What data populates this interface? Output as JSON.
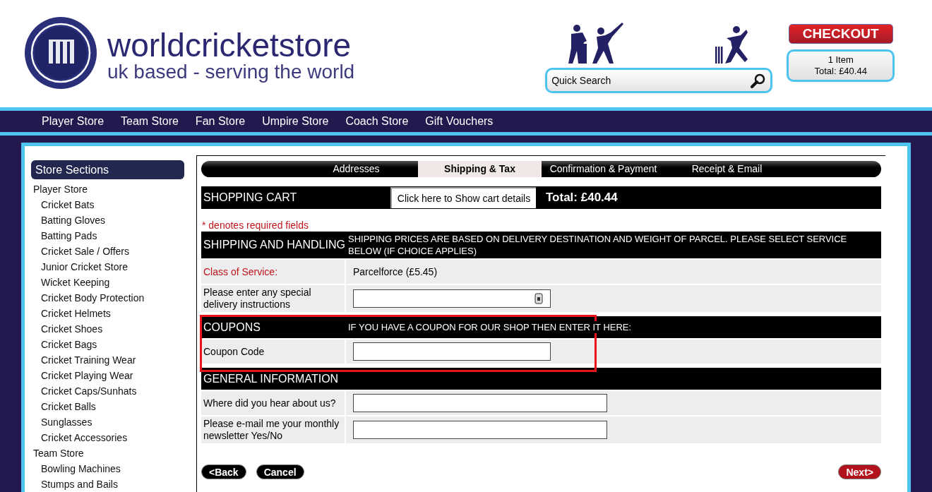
{
  "header": {
    "brand": "worldcricketstore",
    "tagline": "uk based - serving the world",
    "search": {
      "placeholder": "Quick Search"
    },
    "checkout": "CHECKOUT",
    "cart": {
      "items": "1 Item",
      "total": "Total: £40.44"
    }
  },
  "nav": [
    "Player Store",
    "Team Store",
    "Fan Store",
    "Umpire Store",
    "Coach Store",
    "Gift Vouchers"
  ],
  "sidebar": {
    "title": "Store Sections",
    "items": [
      {
        "label": "Player Store",
        "children": [
          {
            "label": "Cricket Bats"
          },
          {
            "label": "Batting Gloves"
          },
          {
            "label": "Batting Pads"
          },
          {
            "label": "Cricket Sale / Offers"
          },
          {
            "label": "Junior Cricket Store"
          },
          {
            "label": "Wicket Keeping"
          },
          {
            "label": "Cricket Body Protection"
          },
          {
            "label": "Cricket Helmets"
          },
          {
            "label": "Cricket Shoes"
          },
          {
            "label": "Cricket Bags"
          },
          {
            "label": "Cricket Training Wear"
          },
          {
            "label": "Cricket Playing Wear"
          },
          {
            "label": "Cricket Caps/Sunhats"
          },
          {
            "label": "Cricket Balls"
          },
          {
            "label": "Sunglasses"
          },
          {
            "label": "Cricket Accessories"
          }
        ]
      },
      {
        "label": "Team Store",
        "children": [
          {
            "label": "Bowling Machines"
          },
          {
            "label": "Stumps and Bails"
          }
        ]
      }
    ]
  },
  "steps": [
    {
      "label": "Addresses",
      "selected": false
    },
    {
      "label": "Shipping & Tax",
      "selected": true
    },
    {
      "label": "Confirmation & Payment",
      "selected": false
    },
    {
      "label": "Receipt & Email",
      "selected": false
    }
  ],
  "cart_bar": {
    "title": "SHOPPING CART",
    "details_button": "Click here to Show cart details",
    "total": "Total: £40.44"
  },
  "required_note": "* denotes required fields",
  "sections": [
    {
      "title": "SHIPPING AND HANDLING",
      "note": "SHIPPING PRICES ARE BASED ON DELIVERY DESTINATION AND WEIGHT OF PARCEL. PLEASE SELECT SERVICE BELOW (IF CHOICE APPLIES)",
      "rows": [
        {
          "kind": "text",
          "label": "Class of Service:",
          "required": true,
          "value": "Parcelforce (£5.45)"
        },
        {
          "kind": "textarea",
          "label": "Please enter any special delivery instructions",
          "required": false
        }
      ]
    },
    {
      "title": "COUPONS",
      "note": "IF YOU HAVE A COUPON FOR OUR SHOP THEN ENTER IT HERE:",
      "rows": [
        {
          "kind": "short_input",
          "label": "Coupon Code",
          "required": false
        }
      ]
    },
    {
      "title": "GENERAL INFORMATION",
      "rows": [
        {
          "kind": "input",
          "label": "Where did you hear about us?",
          "required": false
        },
        {
          "kind": "input",
          "label": "Please e-mail me your monthly newsletter Yes/No",
          "required": false
        }
      ]
    }
  ],
  "buttons": [
    {
      "label": "<Back",
      "kind": "secondary"
    },
    {
      "label": "Cancel",
      "kind": "secondary"
    },
    {
      "label": "Next>",
      "kind": "primary"
    }
  ]
}
